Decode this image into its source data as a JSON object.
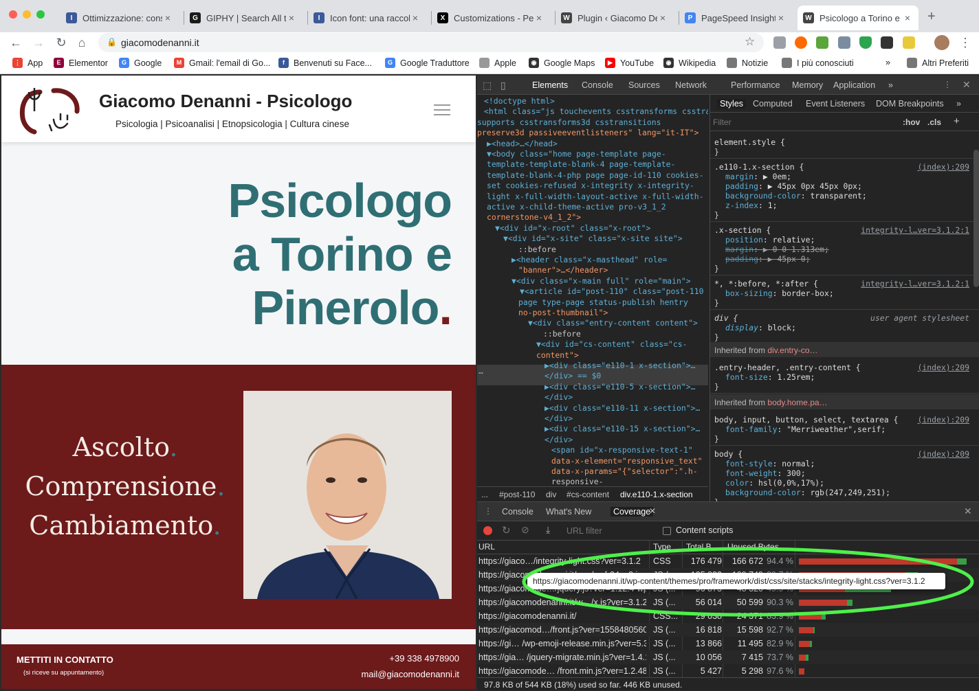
{
  "tabs": [
    {
      "title": "Ottimizzazione: consi",
      "fav": "#3c5a99",
      "glyph": "I"
    },
    {
      "title": "GIPHY | Search All th",
      "fav": "#1a1a1a",
      "glyph": "G"
    },
    {
      "title": "Icon font: una raccolt",
      "fav": "#3c5a99",
      "glyph": "I"
    },
    {
      "title": "Customizations - Per",
      "fav": "#000",
      "glyph": "X"
    },
    {
      "title": "Plugin ‹ Giacomo Den",
      "fav": "#444",
      "glyph": "W"
    },
    {
      "title": "PageSpeed Insights",
      "fav": "#4285f4",
      "glyph": "P"
    },
    {
      "title": "Psicologo a Torino e P",
      "fav": "#444",
      "glyph": "W"
    }
  ],
  "address": {
    "url": "giacomodenanni.it"
  },
  "bookmarks": [
    {
      "label": "App",
      "color": "#ea4335",
      "glyph": "⋮"
    },
    {
      "label": "Elementor",
      "color": "#92003b",
      "glyph": "E"
    },
    {
      "label": "Google",
      "color": "#4285f4",
      "glyph": "G"
    },
    {
      "label": "Gmail: l'email di Go...",
      "color": "#ea4335",
      "glyph": "M"
    },
    {
      "label": "Benvenuti su Face...",
      "color": "#3b5998",
      "glyph": "f"
    },
    {
      "label": "Google Traduttore",
      "color": "#4285f4",
      "glyph": "G"
    },
    {
      "label": "Apple",
      "color": "#999",
      "glyph": ""
    },
    {
      "label": "Google Maps",
      "color": "#333",
      "glyph": "◉"
    },
    {
      "label": "YouTube",
      "color": "#ff0000",
      "glyph": "▶"
    },
    {
      "label": "Wikipedia",
      "color": "#333",
      "glyph": "◉"
    },
    {
      "label": "Notizie",
      "color": "#777",
      "glyph": ""
    },
    {
      "label": "I più conosciuti",
      "color": "#777",
      "glyph": ""
    },
    {
      "label": "»",
      "color": "",
      "glyph": ""
    },
    {
      "label": "Altri Preferiti",
      "color": "#777",
      "glyph": ""
    }
  ],
  "site": {
    "brand": "Giacomo Denanni - Psicologo",
    "tagline": "Psicologia | Psicoanalisi | Etnopsicologia | Cultura cinese",
    "hero_lines": [
      "Psicologo",
      "a Torino e",
      "Pinerolo"
    ],
    "hero_dot": ".",
    "motto": [
      "Ascolto",
      "Comprensione",
      "Cambiamento"
    ],
    "motto_dot": ".",
    "footer": {
      "cta": "METTITI IN CONTATTO",
      "cta_sub": "(si riceve su appuntamento)",
      "phone": "+39 338 4978900",
      "email": "mail@giacomodenanni.it"
    }
  },
  "devtools": {
    "tabs": [
      "Elements",
      "Console",
      "Sources",
      "Network",
      "Performance",
      "Memory",
      "Application",
      "»"
    ],
    "active_tab": "Elements",
    "dom_lines": [
      "<!doctype html>",
      "<html class=\"js touchevents csstransforms csstransforms3d csstransitions",
      "supports csstransforms3d csstransitions",
      "preserve3d passiveeventlisteners\" lang=\"it-IT\">",
      "▶<head>…</head>",
      "▼<body class=\"home page-template page-",
      "template-template-blank-4 page-template-",
      "template-blank-4-php page page-id-110 cookies-",
      "set cookies-refused x-integrity x-integrity-",
      "light x-full-width-layout-active x-full-width-",
      "active x-child-theme-active pro-v3_1_2",
      "cornerstone-v4_1_2\">",
      "▼<div id=\"x-root\" class=\"x-root\">",
      "▼<div id=\"x-site\" class=\"x-site site\">",
      "::before",
      "▶<header class=\"x-masthead\" role=",
      "\"banner\">…</header>",
      "▼<div class=\"x-main full\" role=\"main\">",
      "▼<article id=\"post-110\" class=\"post-110",
      "page type-page status-publish hentry",
      "no-post-thumbnail\">",
      "▼<div class=\"entry-content content\">",
      "::before",
      "▼<div id=\"cs-content\" class=\"cs-",
      "content\">",
      "▶<div class=\"e110-1 x-section\">…",
      "</div> == $0",
      "▶<div class=\"e110-5 x-section\">…",
      "</div>",
      "▶<div class=\"e110-11 x-section\">…",
      "</div>",
      "▶<div class=\"e110-15 x-section\">…",
      "</div>",
      "<span id=\"x-responsive-text-1\"",
      "data-x-element=\"responsive_text\"",
      "data-x-params=\"{\"selector\":\".h-",
      "responsive-"
    ],
    "crumbs": [
      "...",
      "#post-110",
      "div",
      "#cs-content",
      "div.e110-1.x-section"
    ],
    "style_tabs": [
      "Styles",
      "Computed",
      "Event Listeners",
      "DOM Breakpoints",
      "»"
    ],
    "filter_placeholder": "Filter",
    "hov": ":hov",
    "cls": ".cls",
    "rules": [
      {
        "sel": "element.style {",
        "src": "",
        "props": []
      },
      {
        "sel": ".e110-1.x-section {",
        "src": "(index):209",
        "props": [
          [
            "margin",
            "▶ 0em;"
          ],
          [
            "padding",
            "▶ 45px 0px 45px 0px;"
          ],
          [
            "background-color",
            "transparent;"
          ],
          [
            "z-index",
            "1;"
          ]
        ]
      },
      {
        "sel": ".x-section {",
        "src": "integrity-l…ver=3.1.2:1",
        "props": [
          [
            "position",
            "relative;"
          ],
          [
            "margin",
            "▶ 0 0 1.313em;"
          ],
          [
            "padding",
            "▶ 45px 0;"
          ]
        ]
      },
      {
        "sel": "*, *:before, *:after {",
        "src": "integrity-l…ver=3.1.2:1",
        "props": [
          [
            "box-sizing",
            "border-box;"
          ]
        ]
      },
      {
        "sel": "div {",
        "src": "user agent stylesheet",
        "props": [
          [
            "display",
            "block;"
          ]
        ]
      },
      {
        "sel": ".entry-header, .entry-content {",
        "src": "(index):209",
        "props": [
          [
            "font-size",
            "1.25rem;"
          ]
        ]
      },
      {
        "sel": "body, input, button, select, textarea {",
        "src": "(index):209",
        "props": [
          [
            "font-family",
            "\"Merriweather\",serif;"
          ]
        ]
      },
      {
        "sel": "body {",
        "src": "(index):209",
        "props": [
          [
            "font-style",
            "normal;"
          ],
          [
            "font-weight",
            "300;"
          ],
          [
            "color",
            "hsl(0,0%,17%);"
          ],
          [
            "background-color",
            "rgb(247,249,251);"
          ]
        ]
      }
    ],
    "inherited": [
      {
        "label": "Inherited from",
        "from": "div.entry-co…"
      },
      {
        "label": "Inherited from",
        "from": "body.home.pa…"
      }
    ],
    "drawer": {
      "tabs": [
        "Console",
        "What's New",
        "Coverage"
      ],
      "url_filter": "URL filter",
      "content_scripts": "Content scripts",
      "headers": [
        "URL",
        "Type",
        "Total B...",
        "Unused Bytes"
      ],
      "tooltip": "https://giacomodenanni.it/wp-content/themes/pro/framework/dist/css/site/stacks/integrity-light.css?ver=3.1.2",
      "rows": [
        {
          "url": "https://giaco…/integrity-light.css?ver=3.1.2",
          "type": "CSS",
          "total": "176 479",
          "unused": "166 672",
          "pct": "94.4 %",
          "frac": 0.944,
          "w": 1.0
        },
        {
          "url": "https://giacomodenanni.it/w…/cs.fr24ac2.js",
          "type": "JS (...",
          "total": "125 032",
          "unused": "109 749",
          "pct": "89.7 %",
          "frac": 0.897,
          "w": 0.71
        },
        {
          "url": "https://giacomode…/jquery.js?ver=1.12.4-wp",
          "type": "JS (...",
          "total": "96 873",
          "unused": "48 320",
          "pct": "49.9 %",
          "frac": 0.5,
          "w": 0.55
        },
        {
          "url": "https://giacomodenanni.it/w…/x.js?ver=3.1.2",
          "type": "JS (...",
          "total": "56 014",
          "unused": "50 599",
          "pct": "90.3 %",
          "frac": 0.903,
          "w": 0.32
        },
        {
          "url": "https://giacomodenanni.it/",
          "type": "CSS...",
          "total": "29 038",
          "unused": "24 371",
          "pct": "83.9 %",
          "frac": 0.84,
          "w": 0.16
        },
        {
          "url": "https://giacomod…/front.js?ver=1558480560",
          "type": "JS (...",
          "total": "16 818",
          "unused": "15 598",
          "pct": "92.7 %",
          "frac": 0.927,
          "w": 0.095
        },
        {
          "url": "https://gi… /wp-emoji-release.min.js?ver=5.3",
          "type": "JS (...",
          "total": "13 866",
          "unused": "11 495",
          "pct": "82.9 %",
          "frac": 0.829,
          "w": 0.079
        },
        {
          "url": "https://gia… /jquery-migrate.min.js?ver=1.4.1",
          "type": "JS (...",
          "total": "10 056",
          "unused": "7 415",
          "pct": "73.7 %",
          "frac": 0.737,
          "w": 0.057
        },
        {
          "url": "https://giacomode… /front.min.js?ver=1.2.48",
          "type": "JS (...",
          "total": "5 427",
          "unused": "5 298",
          "pct": "97.6 %",
          "frac": 0.976,
          "w": 0.031
        }
      ],
      "summary": "97.8 KB of 544 KB (18%) used so far. 446 KB unused."
    }
  }
}
